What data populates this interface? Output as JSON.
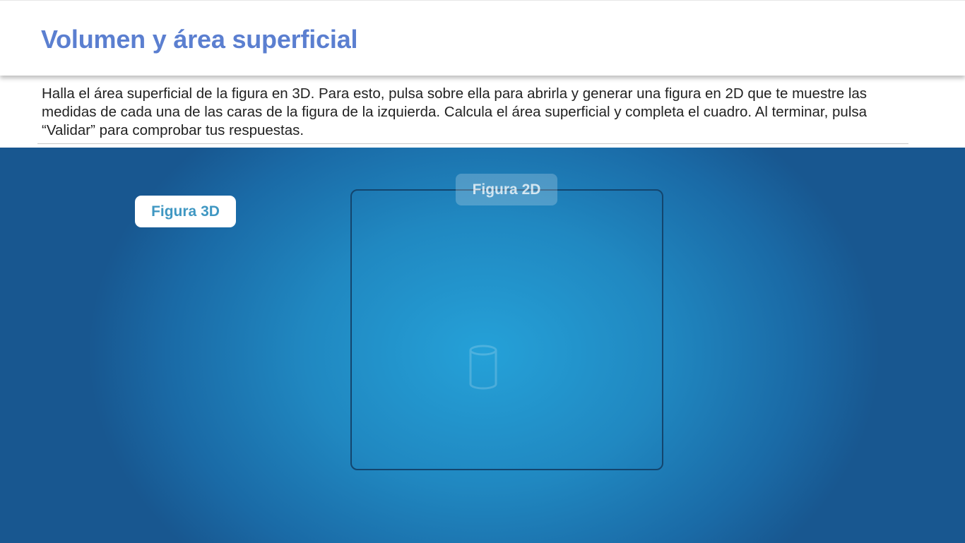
{
  "header": {
    "title": "Volumen y área superficial"
  },
  "instructions": {
    "text": "Halla el área superficial de la figura en 3D. Para esto, pulsa sobre ella para abrirla y generar una figura en 2D que te muestre las medidas de cada una de las caras de la figura de la izquierda. Calcula el área superficial y completa el cuadro. Al terminar, pulsa “Validar” para comprobar tus respuestas."
  },
  "stage": {
    "figure_3d_button": "Figura 3D",
    "figure_2d_label": "Figura 2D",
    "placeholder_icon": "cylinder-icon",
    "colors": {
      "title": "#5b7fd0",
      "stage_center": "#25a1d8",
      "stage_edge": "#185790",
      "button_text": "#3f97c2",
      "panel_border": "#13456e"
    }
  }
}
